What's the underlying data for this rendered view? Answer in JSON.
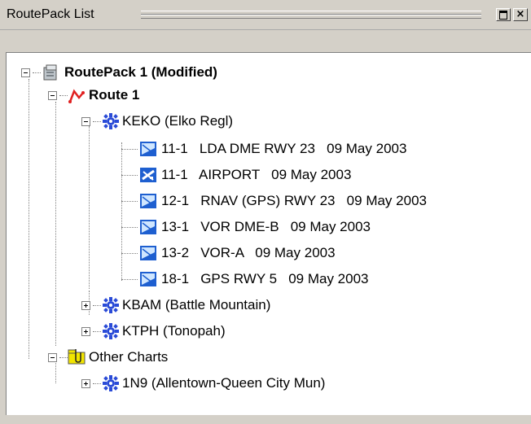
{
  "window": {
    "title": "RoutePack List"
  },
  "tree": {
    "routepack": "RoutePack 1 (Modified)",
    "route": "Route 1",
    "airport1": "KEKO (Elko Regl)",
    "charts": [
      "11-1   LDA DME RWY 23   09 May 2003",
      "11-1   AIRPORT   09 May 2003",
      "12-1   RNAV (GPS) RWY 23   09 May 2003",
      "13-1   VOR DME-B   09 May 2003",
      "13-2   VOR-A   09 May 2003",
      "18-1   GPS RWY 5   09 May 2003"
    ],
    "airport2": "KBAM (Battle Mountain)",
    "airport3": "KTPH (Tonopah)",
    "other": "Other Charts",
    "airport4": "1N9 (Allentown-Queen City Mun)"
  },
  "colors": {
    "airport_icon": "#2a4bd7",
    "chart_icon": "#1e5fd0",
    "route_icon": "#e02020",
    "folder_icon": "#f2e500"
  }
}
